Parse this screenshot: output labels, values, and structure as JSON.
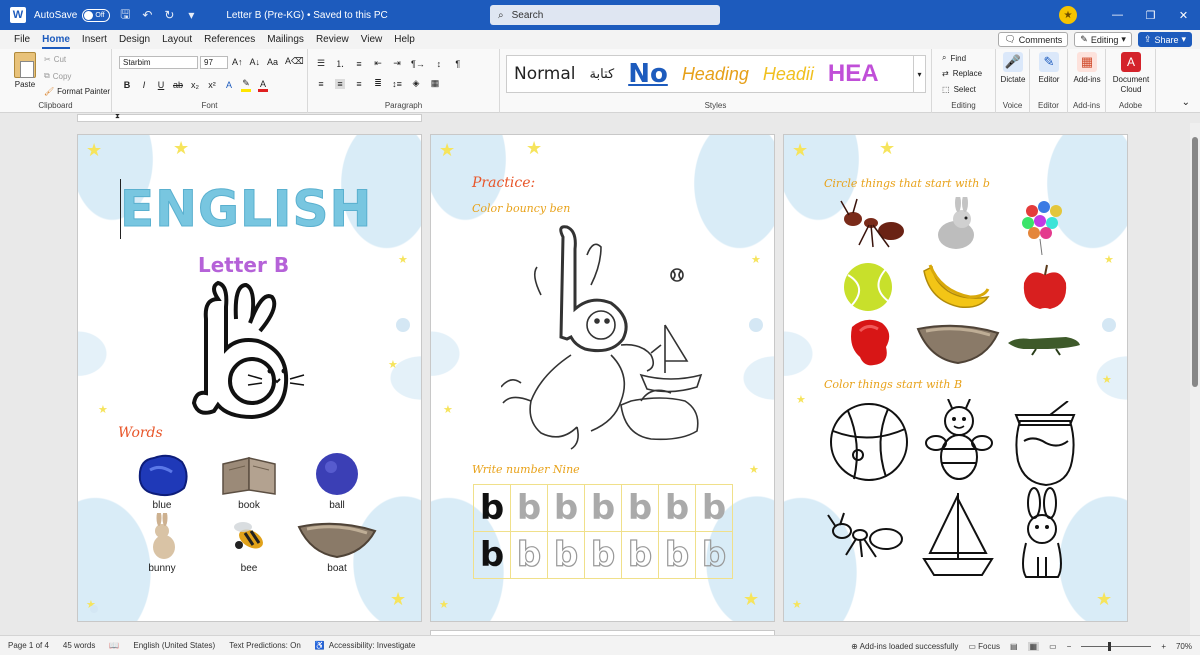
{
  "titlebar": {
    "autosave_label": "AutoSave",
    "autosave_state": "Off",
    "doc_title": "Letter B (Pre-KG)  •  Saved to this PC",
    "search_placeholder": "Search"
  },
  "tabs": [
    "File",
    "Home",
    "Insert",
    "Design",
    "Layout",
    "References",
    "Mailings",
    "Review",
    "View",
    "Help"
  ],
  "active_tab": "Home",
  "tab_actions": {
    "comments": "Comments",
    "editing": "Editing",
    "share": "Share"
  },
  "ribbon": {
    "clipboard": {
      "paste": "Paste",
      "cut": "Cut",
      "copy": "Copy",
      "format_painter": "Format Painter",
      "label": "Clipboard"
    },
    "font": {
      "name": "Starbim",
      "size": "97",
      "label": "Font"
    },
    "paragraph": {
      "label": "Paragraph"
    },
    "styles": {
      "label": "Styles",
      "items": [
        "Normal",
        "كتابة",
        "No",
        "Heading",
        "Headii",
        "HEA"
      ]
    },
    "editing": {
      "find": "Find",
      "replace": "Replace",
      "select": "Select",
      "label": "Editing"
    },
    "voice": {
      "dictate": "Dictate",
      "label": "Voice"
    },
    "editor": {
      "editor": "Editor",
      "label": "Editor"
    },
    "addins": {
      "addins": "Add-ins",
      "label": "Add-ins"
    },
    "adobe": {
      "doc_cloud": "Document Cloud",
      "label": "Adobe"
    }
  },
  "page1": {
    "title": "ENGLISH",
    "subtitle": "Letter B",
    "words_heading": "Words",
    "words": [
      "blue",
      "book",
      "ball",
      "bunny",
      "bee",
      "boat"
    ]
  },
  "page2": {
    "practice": "Practice:",
    "color_instruction": "Color bouncy ben",
    "write_instruction": "Write number Nine",
    "trace_letter": "b"
  },
  "page3": {
    "circle_instruction": "Circle things that start with b",
    "color_instruction": "Color things start with B"
  },
  "statusbar": {
    "page": "Page 1 of 4",
    "words": "45 words",
    "language": "English (United States)",
    "predictions": "Text Predictions: On",
    "accessibility": "Accessibility: Investigate",
    "addins_status": "Add-ins loaded successfully",
    "focus": "Focus",
    "zoom": "70%"
  },
  "colors": {
    "accent": "#1d5bbd",
    "english_title": "#78c6e0",
    "letter_b": "#b562d8",
    "words_heading": "#e8562a"
  }
}
